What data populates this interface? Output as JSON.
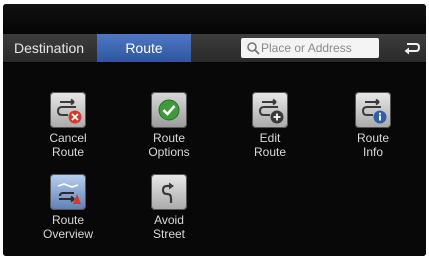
{
  "tabs": {
    "destination": "Destination",
    "route": "Route"
  },
  "search": {
    "placeholder": "Place or Address"
  },
  "back": {
    "icon": "back-arrow-icon"
  },
  "menu": {
    "cancel_route": "Cancel\nRoute",
    "route_options": "Route\nOptions",
    "edit_route": "Edit\nRoute",
    "route_info": "Route\nInfo",
    "route_overview": "Route\nOverview",
    "avoid_street": "Avoid\nStreet"
  },
  "colors": {
    "active_tab": "#3c67b3",
    "background": "#0b0b0b",
    "text": "#d8d8d8"
  }
}
